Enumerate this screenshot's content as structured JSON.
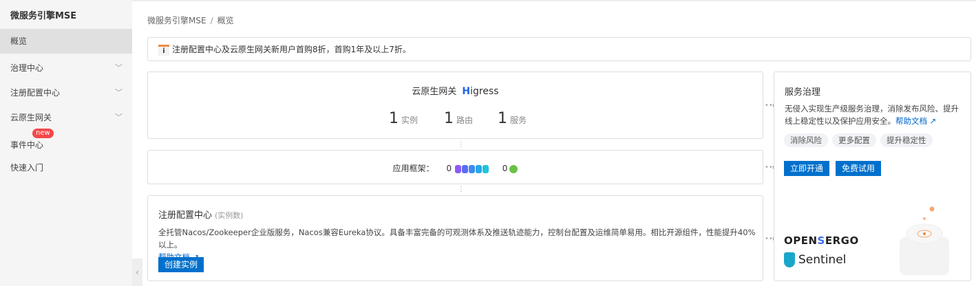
{
  "sidebar": {
    "title": "微服务引擎MSE",
    "items": [
      {
        "label": "概览",
        "active": true
      },
      {
        "label": "治理中心",
        "expandable": true
      },
      {
        "label": "注册配置中心",
        "expandable": true
      },
      {
        "label": "云原生网关",
        "expandable": true
      },
      {
        "label": "事件中心",
        "badge": "new"
      },
      {
        "label": "快速入门"
      }
    ]
  },
  "breadcrumb": [
    "微服务引擎MSE",
    "概览"
  ],
  "notice": {
    "icon": "info-icon",
    "text": "注册配置中心及云原生网关新用户首购8折，首购1年及以上7折。"
  },
  "gateway": {
    "title": "云原生网关",
    "logo": "Higress",
    "stats": [
      {
        "value": "1",
        "label": "实例"
      },
      {
        "value": "1",
        "label": "路由"
      },
      {
        "value": "1",
        "label": "服务"
      }
    ]
  },
  "framework": {
    "label": "应用框架：",
    "dubbo_count": "0",
    "spring_count": "0",
    "colors": [
      "#8a5cf5",
      "#5a6cf0",
      "#3c8cf0",
      "#26a7e8",
      "#22c4d8"
    ]
  },
  "registry": {
    "title": "注册配置中心",
    "subtitle": "(实例数)",
    "desc": "全托管Nacos/Zookeeper企业版服务，Nacos兼容Eureka协议。具备丰富完备的可观测体系及推送轨迹能力，控制台配置及运维简单易用。相比开源组件，性能提升40%以上。",
    "help": "帮助文档",
    "button": "创建实例"
  },
  "governance": {
    "title": "服务治理",
    "desc": "无侵入实现生产级服务治理，消除发布风险、提升线上稳定性以及保护应用安全。",
    "help": "帮助文档",
    "tags": [
      "消除风险",
      "更多配置",
      "提升稳定性"
    ],
    "buttons": [
      "立即开通",
      "免费试用"
    ],
    "logos": [
      "OPENSERGO",
      "Sentinel"
    ]
  }
}
